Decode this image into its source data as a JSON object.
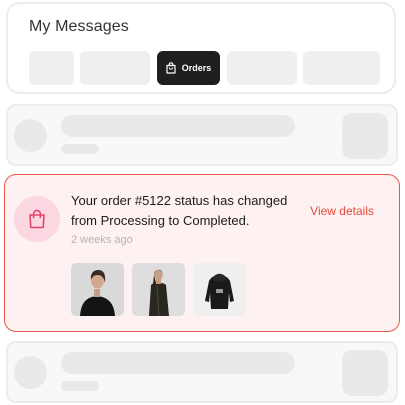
{
  "header": {
    "title": "My Messages",
    "tabs": [
      {
        "label": "",
        "active": false
      },
      {
        "label": "",
        "active": false
      },
      {
        "label": "Orders",
        "active": true,
        "icon": "bag-icon"
      },
      {
        "label": "",
        "active": false
      },
      {
        "label": "",
        "active": false
      }
    ]
  },
  "notification": {
    "icon": "shopping-bag-icon",
    "message": "Your order #5122 status has changed from Processing to Completed.",
    "time": "2 weeks ago",
    "action_label": "View details",
    "products": [
      {
        "name": "product-black-sweater"
      },
      {
        "name": "product-long-coat"
      },
      {
        "name": "product-black-hoodie"
      }
    ]
  },
  "colors": {
    "accent": "#e64a3c",
    "active_tab": "#1f1f1f",
    "icon_bg": "#fbd7e2"
  }
}
